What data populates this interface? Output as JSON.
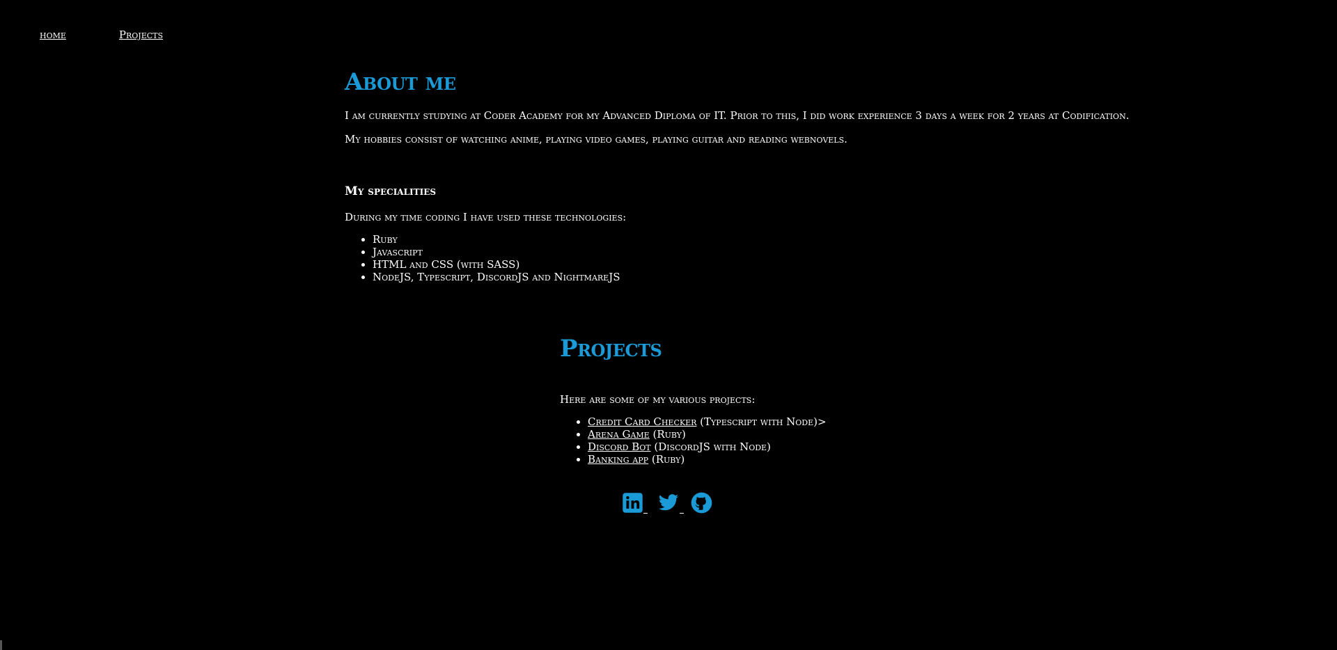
{
  "nav": {
    "home_label": "home",
    "projects_label": "Projects"
  },
  "about": {
    "title": "About me",
    "paragraph1": "I am currently studying at Coder Academy for my Advanced Diploma of IT. Prior to this, I did work experience 3 days a week for 2 years at Codification.",
    "paragraph2": "My hobbies consist of watching anime, playing video games, playing guitar and reading webnovels.",
    "specialities_heading": "My specialities",
    "specialities_intro": "During my time coding I have used these technologies:",
    "technologies": [
      "Ruby",
      "Javascript",
      "HTML and CSS (with SASS)",
      "NodeJS, Typescript, DiscordJS and NightmareJS"
    ]
  },
  "projects": {
    "title": "Projects",
    "intro": "Here are some of my various projects:",
    "items": [
      {
        "link": "Credit Card Checker",
        "note": " (Typescript with Node)>"
      },
      {
        "link": "Arena Game",
        "note": " (Ruby)"
      },
      {
        "link": "Discord Bot",
        "note": " (DiscordJS with Node)"
      },
      {
        "link": "Banking app",
        "note": " (Ruby)"
      }
    ]
  },
  "social": {
    "icons": [
      "linkedin-icon",
      "twitter-icon",
      "github-icon"
    ],
    "color": "#1a9ad6"
  },
  "colors": {
    "background": "#000000",
    "text": "#ffffff",
    "accent": "#1a9ad6"
  }
}
